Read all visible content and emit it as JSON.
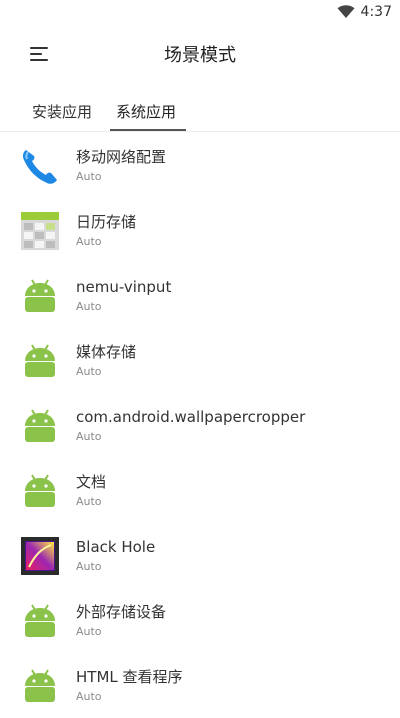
{
  "status_bar": {
    "time": "4:37"
  },
  "app_bar": {
    "title": "场景模式",
    "menu_icon": "menu-icon"
  },
  "tabs": [
    {
      "label": "安装应用",
      "active": false
    },
    {
      "label": "系统应用",
      "active": true
    }
  ],
  "apps": [
    {
      "name": "移动网络配置",
      "mode": "Auto",
      "icon": "phone-icon"
    },
    {
      "name": "日历存储",
      "mode": "Auto",
      "icon": "calendar-storage-icon"
    },
    {
      "name": "nemu-vinput",
      "mode": "Auto",
      "icon": "android-icon"
    },
    {
      "name": "媒体存储",
      "mode": "Auto",
      "icon": "android-icon"
    },
    {
      "name": "com.android.wallpapercropper",
      "mode": "Auto",
      "icon": "android-icon"
    },
    {
      "name": "文档",
      "mode": "Auto",
      "icon": "android-icon"
    },
    {
      "name": "Black Hole",
      "mode": "Auto",
      "icon": "black-hole-icon"
    },
    {
      "name": "外部存储设备",
      "mode": "Auto",
      "icon": "android-icon"
    },
    {
      "name": "HTML 查看程序",
      "mode": "Auto",
      "icon": "android-icon"
    }
  ],
  "colors": {
    "android_green": "#8bc34a",
    "accent": "#555555"
  }
}
